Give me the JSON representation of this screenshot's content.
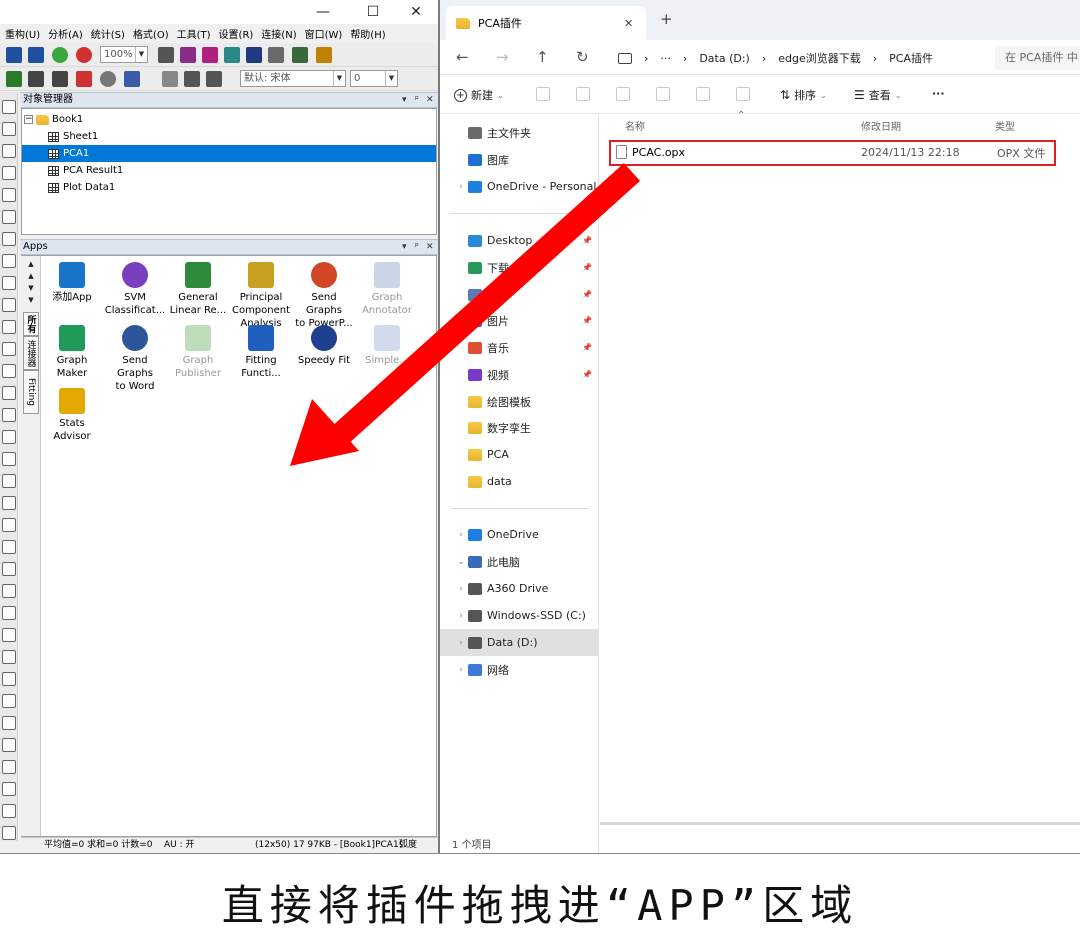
{
  "origin": {
    "window_controls": {
      "minimize": "—",
      "maximize": "☐",
      "close": "✕"
    },
    "menu": [
      "重构(U)",
      "分析(A)",
      "统计(S)",
      "格式(O)",
      "工具(T)",
      "设置(R)",
      "连接(N)",
      "窗口(W)",
      "帮助(H)"
    ],
    "zoom": "100%",
    "font_combo": "默认: 宋体",
    "size_combo": "0",
    "object_manager": {
      "title": "对象管理器",
      "items": [
        {
          "label": "Book1",
          "type": "folder"
        },
        {
          "label": "Sheet1",
          "type": "sheet"
        },
        {
          "label": "PCA1",
          "type": "sheet"
        },
        {
          "label": "PCA Result1",
          "type": "sheet"
        },
        {
          "label": "Plot Data1",
          "type": "sheet"
        }
      ],
      "selected": "PCA1",
      "controls": {
        "dropdown": "▾",
        "pin": "ᵖ",
        "close": "✕"
      }
    },
    "apps": {
      "title": "Apps",
      "vertical_tabs": [
        "所有",
        "连接器",
        "Fitting"
      ],
      "tiles": [
        {
          "label": "添加App",
          "name": "add-app",
          "color": "#1a74c9",
          "dim": false
        },
        {
          "label": "SVM\nClassificat...",
          "name": "svm-classification",
          "color": "#7a3fbf",
          "dim": false
        },
        {
          "label": "General\nLinear Re...",
          "name": "general-linear-regression",
          "color": "#2e8b3a",
          "dim": false
        },
        {
          "label": "Principal\nComponent\nAnalysis",
          "name": "principal-component-analysis",
          "color": "#c8a020",
          "dim": false
        },
        {
          "label": "Send Graphs\nto PowerP...",
          "name": "send-graphs-to-powerpoint",
          "color": "#d24726",
          "dim": false
        },
        {
          "label": "Graph\nAnnotator",
          "name": "graph-annotator",
          "color": "#8aa4c8",
          "dim": true
        },
        {
          "label": "Graph\nMaker",
          "name": "graph-maker",
          "color": "#1f9a5a",
          "dim": false
        },
        {
          "label": "Send Graphs\nto Word",
          "name": "send-graphs-to-word",
          "color": "#2b579a",
          "dim": false
        },
        {
          "label": "Graph\nPublisher",
          "name": "graph-publisher",
          "color": "#6cb46c",
          "dim": true
        },
        {
          "label": "Fitting\nFuncti...",
          "name": "fitting-function",
          "color": "#1f5fbf",
          "dim": false
        },
        {
          "label": "Speedy Fit",
          "name": "speedy-fit",
          "color": "#1f3f8f",
          "dim": false
        },
        {
          "label": "Simple...",
          "name": "simple-app",
          "color": "#9ab0d8",
          "dim": true
        },
        {
          "label": "Stats\nAdvisor",
          "name": "stats-advisor",
          "color": "#e0a800",
          "dim": false
        }
      ]
    },
    "status": {
      "stats": "平均值=0 求和=0 计数=0",
      "au": "AU : 开",
      "info": "(12x50) 17  97KB - [Book1]PCA1!",
      "unit": "弧度"
    }
  },
  "explorer": {
    "tab_title": "PCA插件",
    "tab_close": "✕",
    "new_tab": "+",
    "nav": {
      "back": "←",
      "forward": "→",
      "up": "↑",
      "refresh": "↻"
    },
    "breadcrumb": [
      "Data (D:)",
      "edge浏览器下载",
      "PCA插件"
    ],
    "more_crumbs": "···",
    "search_placeholder": "在 PCA插件 中",
    "commands": {
      "new": "新建",
      "sort": "排序",
      "view": "查看",
      "more": "···"
    },
    "nav_items": [
      {
        "label": "主文件夹",
        "icon": "home-icon",
        "pinned": false,
        "chevron": false
      },
      {
        "label": "图库",
        "icon": "gallery-icon",
        "pinned": false,
        "chevron": false
      },
      {
        "label": "OneDrive - Personal",
        "icon": "cloud-icon",
        "pinned": false,
        "chevron": true
      },
      {
        "label": "Desktop",
        "icon": "desktop-icon",
        "pinned": true,
        "chevron": false
      },
      {
        "label": "下载",
        "icon": "download-icon",
        "pinned": true,
        "chevron": false
      },
      {
        "label": "",
        "icon": "document-icon",
        "pinned": true,
        "chevron": false
      },
      {
        "label": "图片",
        "icon": "pictures-icon",
        "pinned": true,
        "chevron": false
      },
      {
        "label": "音乐",
        "icon": "music-icon",
        "pinned": true,
        "chevron": false
      },
      {
        "label": "视频",
        "icon": "video-icon",
        "pinned": true,
        "chevron": false
      },
      {
        "label": "绘图模板",
        "icon": "folder-icon",
        "pinned": false,
        "chevron": false
      },
      {
        "label": "数字孪生",
        "icon": "folder-icon",
        "pinned": false,
        "chevron": false
      },
      {
        "label": "PCA",
        "icon": "folder-icon",
        "pinned": false,
        "chevron": false
      },
      {
        "label": "data",
        "icon": "folder-icon",
        "pinned": false,
        "chevron": false
      },
      {
        "label": "OneDrive",
        "icon": "cloud-icon",
        "pinned": false,
        "chevron": true
      },
      {
        "label": "此电脑",
        "icon": "pc-icon",
        "pinned": false,
        "chevron": true
      },
      {
        "label": "A360 Drive",
        "icon": "drive-icon",
        "pinned": false,
        "chevron": true
      },
      {
        "label": "Windows-SSD (C:)",
        "icon": "drive-icon",
        "pinned": false,
        "chevron": true
      },
      {
        "label": "Data (D:)",
        "icon": "drive-icon",
        "pinned": false,
        "chevron": true
      },
      {
        "label": "网络",
        "icon": "network-icon",
        "pinned": false,
        "chevron": true
      }
    ],
    "selected_nav": "Data (D:)",
    "columns": {
      "name": "名称",
      "date": "修改日期",
      "type": "类型"
    },
    "files": [
      {
        "name": "PCAC.opx",
        "date": "2024/11/13 22:18",
        "type": "OPX 文件"
      }
    ],
    "item_count": "1 个项目"
  },
  "annotation": {
    "caption": "直接将插件拖拽进“APP”区域",
    "arrow_color": "#ff0000",
    "highlight_color": "#e02020"
  }
}
